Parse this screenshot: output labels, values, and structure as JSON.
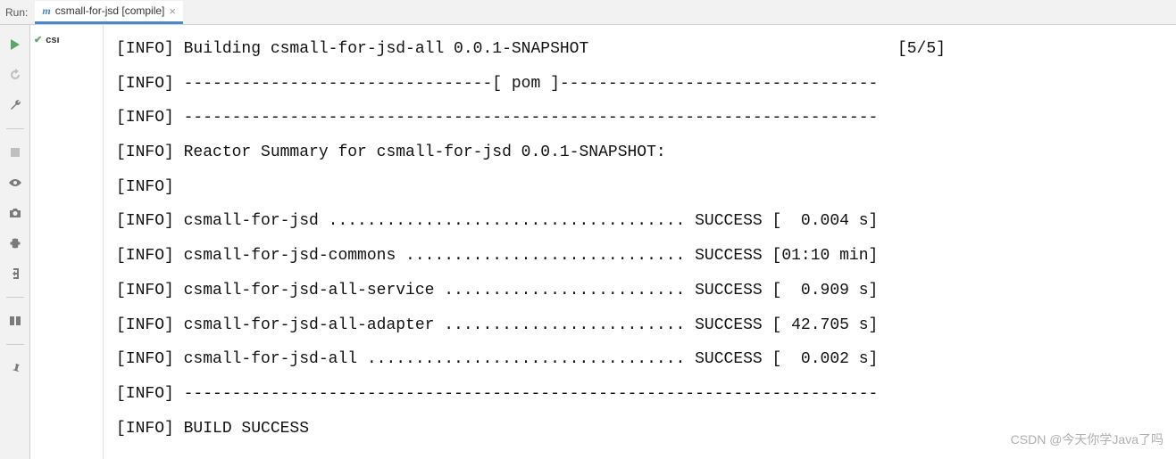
{
  "header": {
    "run_label": "Run:",
    "tab_icon": "m",
    "tab_text": "csmall-for-jsd [compile]",
    "tab_close": "×"
  },
  "tree": {
    "item_label": "csı"
  },
  "console": {
    "lines": [
      "[INFO] Building csmall-for-jsd-all 0.0.1-SNAPSHOT                                [5/5]",
      "[INFO] --------------------------------[ pom ]---------------------------------",
      "[INFO] ------------------------------------------------------------------------",
      "[INFO] Reactor Summary for csmall-for-jsd 0.0.1-SNAPSHOT:",
      "[INFO]",
      "[INFO] csmall-for-jsd ..................................... SUCCESS [  0.004 s]",
      "[INFO] csmall-for-jsd-commons ............................. SUCCESS [01:10 min]",
      "[INFO] csmall-for-jsd-all-service ......................... SUCCESS [  0.909 s]",
      "[INFO] csmall-for-jsd-all-adapter ......................... SUCCESS [ 42.705 s]",
      "[INFO] csmall-for-jsd-all ................................. SUCCESS [  0.002 s]",
      "[INFO] ------------------------------------------------------------------------",
      "[INFO] BUILD SUCCESS"
    ]
  },
  "watermark": "CSDN @今天你学Java了吗"
}
